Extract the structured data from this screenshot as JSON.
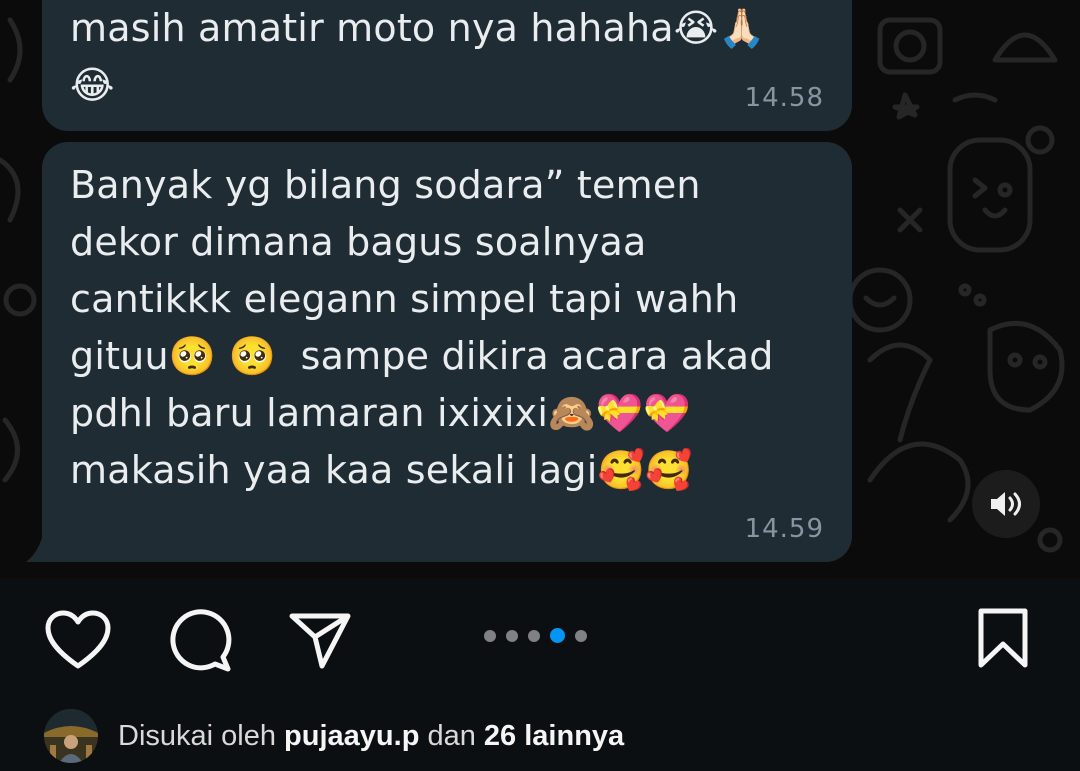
{
  "chat": {
    "messages": [
      {
        "text": "masih amatir moto nya hahaha😭🙏🏻\n😂",
        "time": "14.58"
      },
      {
        "text": "Banyak yg bilang sodara” temen\ndekor dimana bagus soalnyaa\ncantikkk elegann simpel tapi wahh\ngituu🥺 🥺  sampe dikira acara akad\npdhl baru lamaran ixixixi🙈💝💝\nmakasih yaa kaa sekali lagi🥰🥰",
        "time": "14.59"
      }
    ],
    "speaker_icon": "speaker-volume-icon"
  },
  "post_actions": {
    "like_icon": "heart-icon",
    "comment_icon": "comment-bubble-icon",
    "share_icon": "paper-plane-icon",
    "save_icon": "bookmark-icon",
    "carousel": {
      "total": 5,
      "active_index": 4
    }
  },
  "likes": {
    "prefix": "Disukai oleh",
    "user": "pujaayu.p",
    "connector": "dan",
    "others": "26 lainnya"
  },
  "colors": {
    "bubble": "#202c33",
    "timestamp": "#8696a0",
    "accent_dot": "#0095f6",
    "background": "#0b0f11"
  }
}
